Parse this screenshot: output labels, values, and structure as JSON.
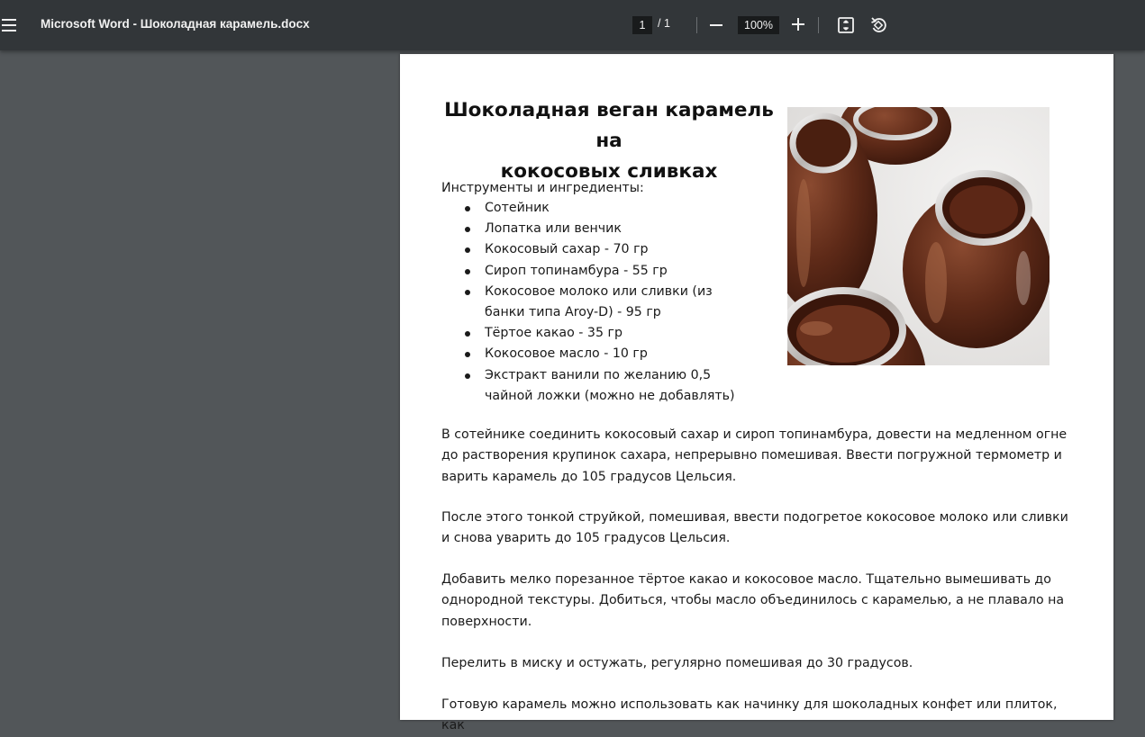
{
  "toolbar": {
    "document_title": "Microsoft Word - Шоколадная карамель.docx",
    "current_page": "1",
    "page_total_text": "/ 1",
    "zoom": "100%",
    "icons": [
      "menu-icon",
      "zoom-out-icon",
      "zoom-in-icon",
      "fit-page-icon",
      "rotate-icon"
    ]
  },
  "document": {
    "title_line1": "Шоколадная веган карамель на",
    "title_line2": "кокосовых сливках",
    "ingredients_heading": "Инструменты и ингредиенты:",
    "ingredients": [
      "Сотейник",
      "Лопатка или венчик",
      "Кокосовый сахар - 70 гр",
      "Сироп топинамбура - 55 гр",
      "Кокосовое молоко или сливки (из банки типа Aroy-D) - 95 гр",
      "Тёртое какао - 35 гр",
      "Кокосовое масло - 10 гр",
      "Экстракт ванили по желанию 0,5 чайной ложки (можно не добавлять)"
    ],
    "paragraphs": [
      "В сотейнике соединить кокосовый сахар и сироп топинамбура, довести на медленном огне до растворения крупинок сахара, непрерывно помешивая. Ввести погружной термометр и варить карамель до 105 градусов Цельсия.",
      "После этого тонкой струйкой, помешивая, ввести подогретое кокосовое молоко или сливки и снова уварить до 105 градусов Цельсия.",
      "Добавить мелко порезанное тёртое какао и кокосовое масло. Тщательно вымешивать до однородной текстуры. Добиться, чтобы масло объединилось с карамелью, а не плавало на поверхности.",
      "Перелить в миску и остужать, регулярно помешивая до 30 градусов.",
      "Готовую карамель можно использовать как начинку для шоколадных конфет или плиток, как"
    ]
  },
  "colors": {
    "toolbar_bg": "#323639",
    "viewer_bg": "#525659",
    "page_bg": "#ffffff",
    "input_bg": "#191b1c"
  }
}
